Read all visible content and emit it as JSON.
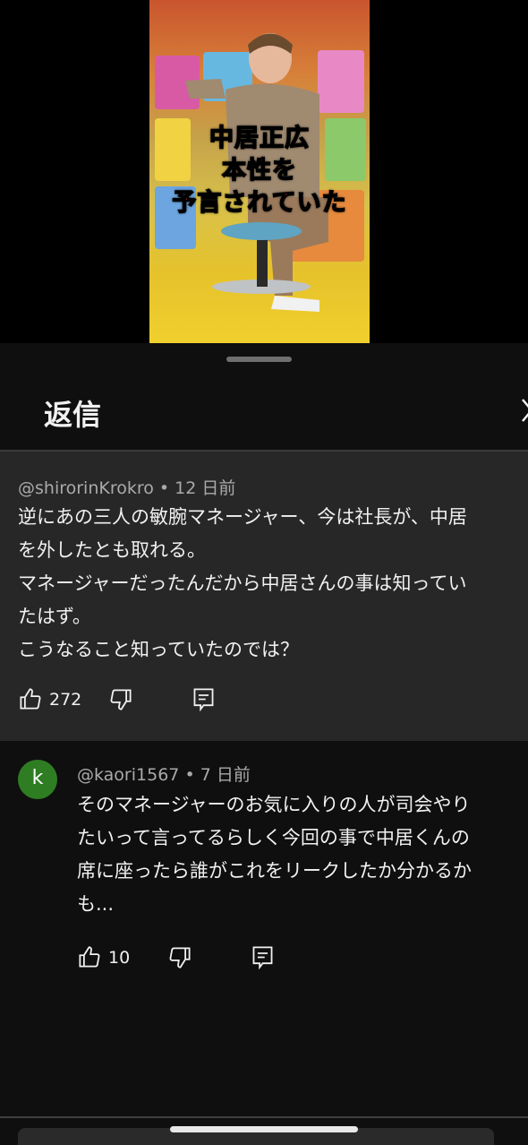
{
  "video": {
    "caption_lines": [
      "中居正広",
      "本性を",
      "予言されていた"
    ]
  },
  "sheet": {
    "title": "返信",
    "close_icon": "chevron-right-icon"
  },
  "parent_comment": {
    "author": "@shirorinKrokro",
    "time": "12 日前",
    "lines": [
      "逆にあの三人の敏腕マネージャー、今は社長が、中居",
      "を外したとも取れる。",
      "マネージャーだったんだから中居さんの事は知ってい",
      "たはず。",
      "こうなること知っていたのでは？"
    ],
    "likes": "272",
    "icons": [
      "thumb-up-icon",
      "thumb-down-icon",
      "reply-icon"
    ]
  },
  "reply": {
    "avatar_letter": "k",
    "avatar_color": "#2f7d23",
    "author": "@kaori1567",
    "time": "7 日前",
    "lines": [
      "そのマネージャーのお気に入りの人が司会やり",
      "たいって言ってるらしく今回の事で中居くんの",
      "席に座ったら誰がこれをリークしたか分かるか",
      "も..."
    ],
    "likes": "10",
    "icons": [
      "thumb-up-icon",
      "thumb-down-icon",
      "reply-icon"
    ]
  }
}
